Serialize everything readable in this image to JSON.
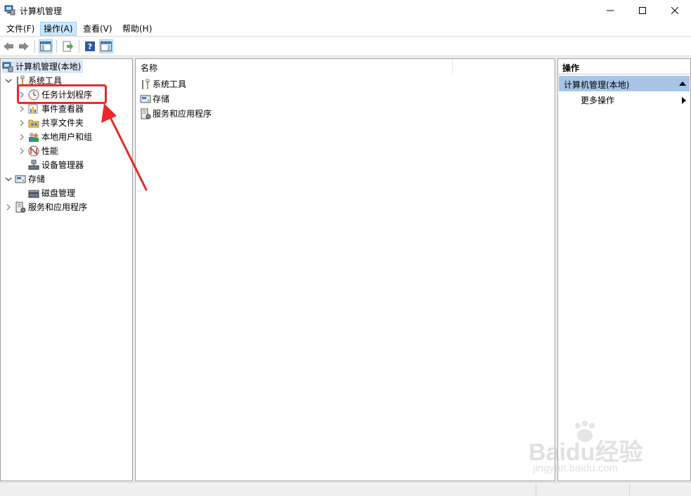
{
  "window": {
    "title": "计算机管理"
  },
  "menu": [
    {
      "label": "文件(F)",
      "active": false
    },
    {
      "label": "操作(A)",
      "active": true
    },
    {
      "label": "查看(V)",
      "active": false
    },
    {
      "label": "帮助(H)",
      "active": false
    }
  ],
  "toolbar": {
    "buttons": [
      "back-icon",
      "forward-icon",
      "show-hide-console-tree-icon",
      "export-list-icon",
      "help-icon",
      "show-hide-action-pane-icon"
    ]
  },
  "tree": {
    "root": "计算机管理(本地)",
    "items": [
      {
        "label": "系统工具"
      },
      {
        "label": "任务计划程序"
      },
      {
        "label": "事件查看器"
      },
      {
        "label": "共享文件夹"
      },
      {
        "label": "本地用户和组"
      },
      {
        "label": "性能"
      },
      {
        "label": "设备管理器"
      },
      {
        "label": "存储"
      },
      {
        "label": "磁盘管理"
      },
      {
        "label": "服务和应用程序"
      }
    ]
  },
  "center": {
    "column_header": "名称",
    "items": [
      "系统工具",
      "存储",
      "服务和应用程序"
    ]
  },
  "actions": {
    "header": "操作",
    "section": "计算机管理(本地)",
    "items": [
      "更多操作"
    ]
  },
  "watermark": {
    "brand": "Baidu经验",
    "url": "jingyan.baidu.com"
  },
  "colors": {
    "highlight": "#e8292a",
    "selection": "#cce8ff",
    "action_section": "#a7c4e5"
  }
}
